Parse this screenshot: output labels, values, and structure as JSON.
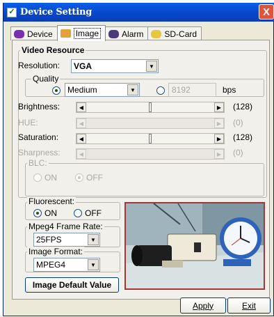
{
  "window": {
    "title": "Device Setting",
    "close_glyph": "X"
  },
  "tabs": [
    {
      "label": "Device",
      "icon": "hardware-icon"
    },
    {
      "label": "Image",
      "icon": "image-icon",
      "active": true
    },
    {
      "label": "Alarm",
      "icon": "alarm-icon"
    },
    {
      "label": "SD-Card",
      "icon": "sdcard-icon"
    }
  ],
  "video": {
    "group_title": "Video Resource",
    "resolution_label": "Resolution:",
    "resolution_value": "VGA",
    "quality_caption": "Quality",
    "quality_value": "Medium",
    "bitrate_value": "8192",
    "bitrate_unit": "bps"
  },
  "sliders": {
    "brightness": {
      "label": "Brightness:",
      "value_text": "(128)",
      "value": 128,
      "max": 255
    },
    "hue": {
      "label": "HUE:",
      "value_text": "(0)",
      "value": 0,
      "max": 255
    },
    "saturation": {
      "label": "Saturation:",
      "value_text": "(128)",
      "value": 128,
      "max": 255
    },
    "sharpness": {
      "label": "Sharpness:",
      "value_text": "(0)",
      "value": 0,
      "max": 255
    }
  },
  "blc": {
    "caption": "BLC:",
    "on_label": "ON",
    "off_label": "OFF",
    "selected": "OFF"
  },
  "fluorescent": {
    "caption": "Fluorescent:",
    "on_label": "ON",
    "off_label": "OFF",
    "selected": "ON"
  },
  "frame_rate": {
    "caption": "Mpeg4 Frame Rate:",
    "value": "25FPS"
  },
  "image_format": {
    "caption": "Image Format:",
    "value": "MPEG4"
  },
  "buttons": {
    "default": "Image Default Value",
    "apply": "Apply",
    "exit": "Exit"
  }
}
